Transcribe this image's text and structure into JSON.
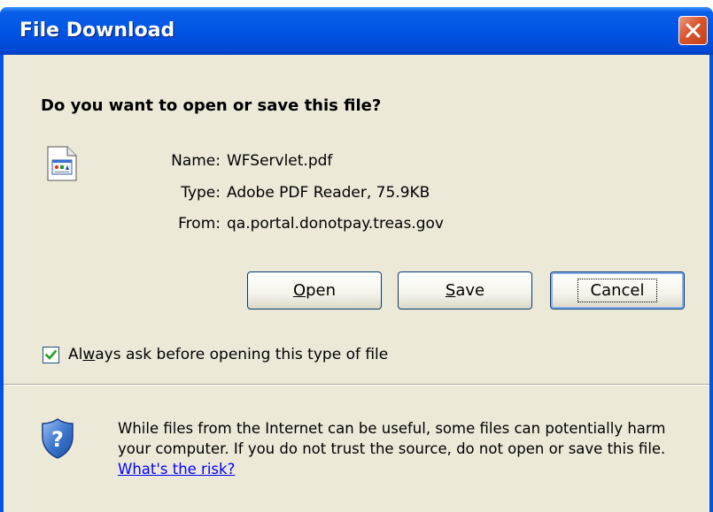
{
  "window": {
    "title": "File Download",
    "question": "Do you want to open or save this file?"
  },
  "file": {
    "name_label": "Name:",
    "name_value": "WFServlet.pdf",
    "type_label": "Type:",
    "type_value": "Adobe PDF Reader, 75.9KB",
    "from_label": "From:",
    "from_value": "qa.portal.donotpay.treas.gov"
  },
  "buttons": {
    "open_pre": "",
    "open_mnemonic": "O",
    "open_post": "pen",
    "save_pre": "",
    "save_mnemonic": "S",
    "save_post": "ave",
    "cancel": "Cancel"
  },
  "checkbox": {
    "checked": true,
    "label_pre": "Al",
    "label_mnemonic": "w",
    "label_post": "ays ask before opening this type of file"
  },
  "warning": {
    "text": "While files from the Internet can be useful, some files can potentially harm your computer. If you do not trust the source, do not open or save this file.",
    "link": "What's the risk?"
  },
  "colors": {
    "titlebar": "#0054e3",
    "client_bg": "#ece9d8",
    "close_button": "#d9552c",
    "link": "#0000ff"
  },
  "icons": {
    "close": "close-icon",
    "file": "file-icon",
    "shield": "shield-help-icon",
    "checkmark": "checkmark-icon"
  }
}
